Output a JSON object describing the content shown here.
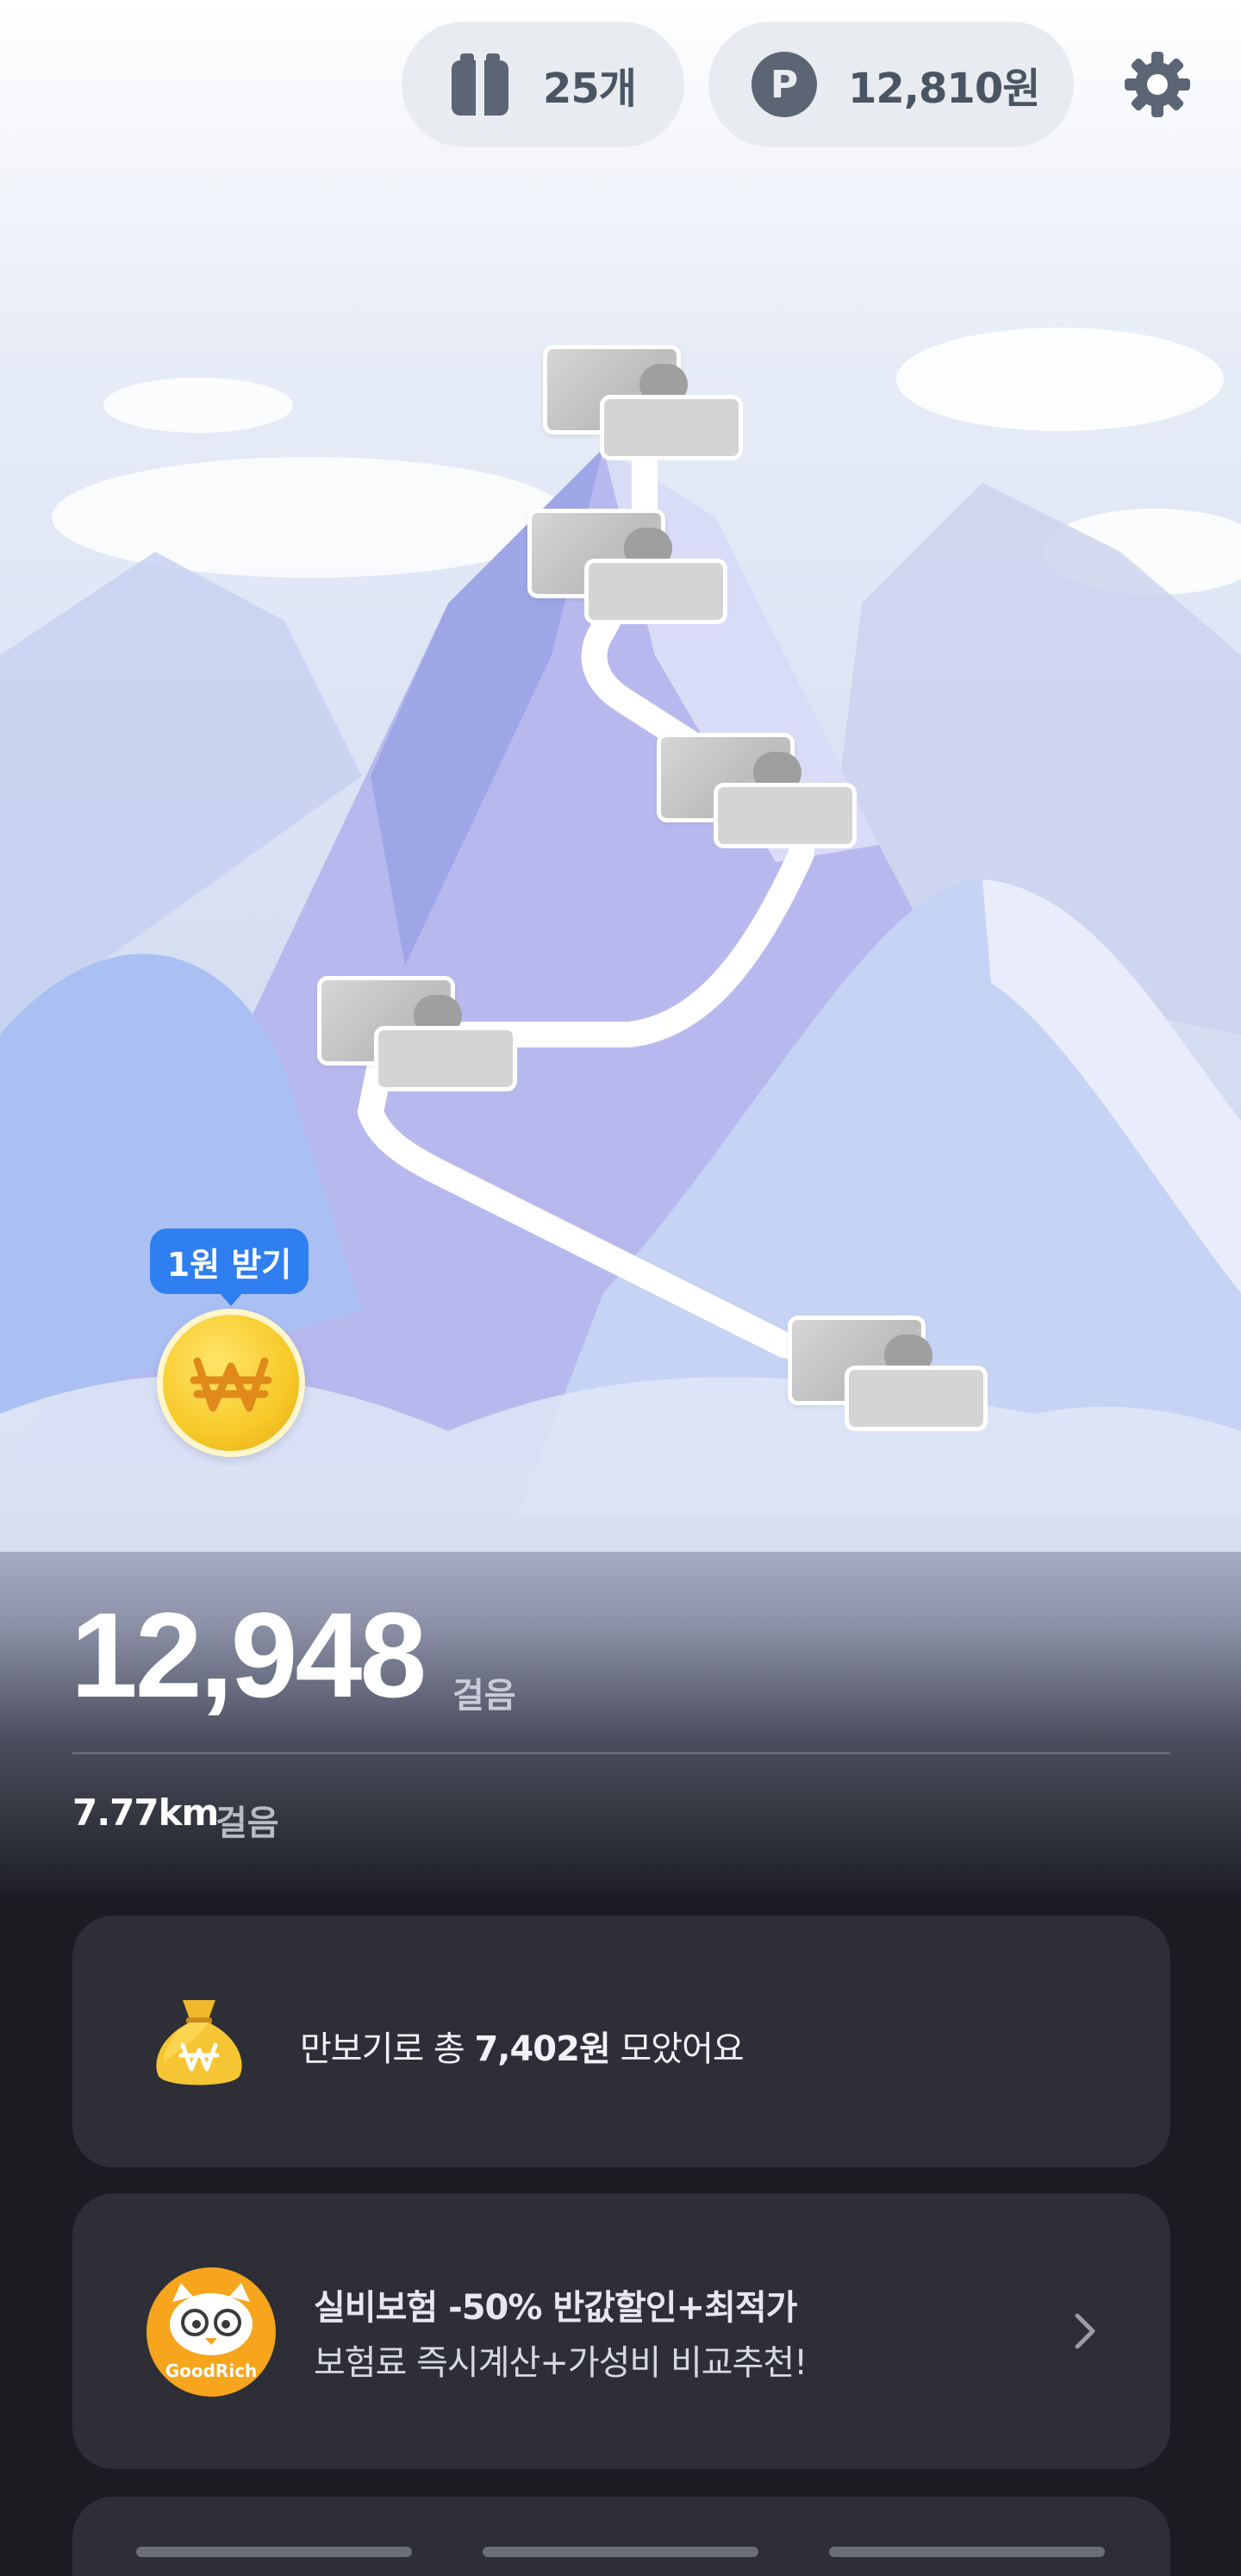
{
  "header": {
    "tickets_label": "25개",
    "points_label": "12,810원",
    "points_badge": "P"
  },
  "map": {
    "reward_label": "1원 받기",
    "coin_symbol": "₩"
  },
  "steps": {
    "count": "12,948",
    "unit": "걸음",
    "distance": "7.77km",
    "distance_unit": "걸음"
  },
  "total_card": {
    "prefix": "만보기로 총 ",
    "amount": "7,402원",
    "suffix": " 모았어요"
  },
  "ad_card": {
    "title": "실비보험 -50% 반값할인+최적가",
    "subtitle": "보험료 즉시계산+가성비 비교추천!",
    "logo_text": "GoodRich"
  },
  "colors": {
    "accent_blue": "#2f7ff0",
    "coin_gold": "#f7c928",
    "card_dark": "#2d2e36",
    "pill_bg": "#e8ebf0"
  },
  "icons": {
    "tickets": "ticket-icon",
    "points": "p-badge-icon",
    "settings": "gear-icon",
    "money_bag": "money-bag-icon",
    "chevron": "chevron-right-icon"
  }
}
